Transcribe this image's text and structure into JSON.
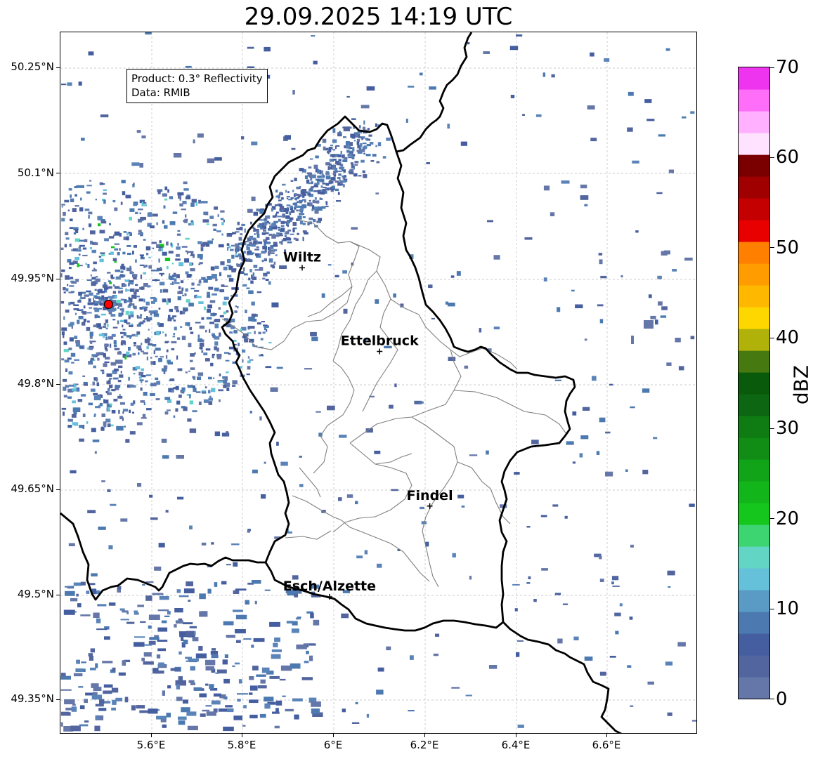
{
  "title": "29.09.2025 14:19 UTC",
  "info_box": {
    "product": "Product: 0.3° Reflectivity",
    "data": "Data: RMIB"
  },
  "lat_ticks": [
    "50.25°N",
    "50.1°N",
    "49.95°N",
    "49.8°N",
    "49.65°N",
    "49.5°N",
    "49.35°N"
  ],
  "lon_ticks": [
    "5.6°E",
    "5.8°E",
    "6°E",
    "6.2°E",
    "6.4°E",
    "6.6°E"
  ],
  "cities": [
    {
      "name": "Wiltz",
      "lon": 5.93,
      "lat": 49.966
    },
    {
      "name": "Ettelbruck",
      "lon": 6.1,
      "lat": 49.847
    },
    {
      "name": "Findel",
      "lon": 6.21,
      "lat": 49.627
    },
    {
      "name": "Esch/Alzette",
      "lon": 5.99,
      "lat": 49.498
    }
  ],
  "radar_site": {
    "lon": 5.505,
    "lat": 49.914
  },
  "colorbar": {
    "label": "dBZ",
    "min": 0,
    "max": 70,
    "ticks": [
      "0",
      "10",
      "20",
      "30",
      "40",
      "50",
      "60",
      "70"
    ],
    "colors": [
      "#6577a8",
      "#52659f",
      "#445e9f",
      "#4c7ab0",
      "#5a9bc6",
      "#65c0da",
      "#63d5c4",
      "#3dd472",
      "#15c61d",
      "#12b51a",
      "#12a418",
      "#118c15",
      "#0f7b13",
      "#0d6612",
      "#0a5a0c",
      "#467a10",
      "#b0b20a",
      "#ffd700",
      "#ffb800",
      "#ff9d00",
      "#ff7f00",
      "#e80000",
      "#c40000",
      "#a00000",
      "#7a0000",
      "#ffe2ff",
      "#ffb0ff",
      "#ff6ef8",
      "#ee34ee"
    ]
  }
}
